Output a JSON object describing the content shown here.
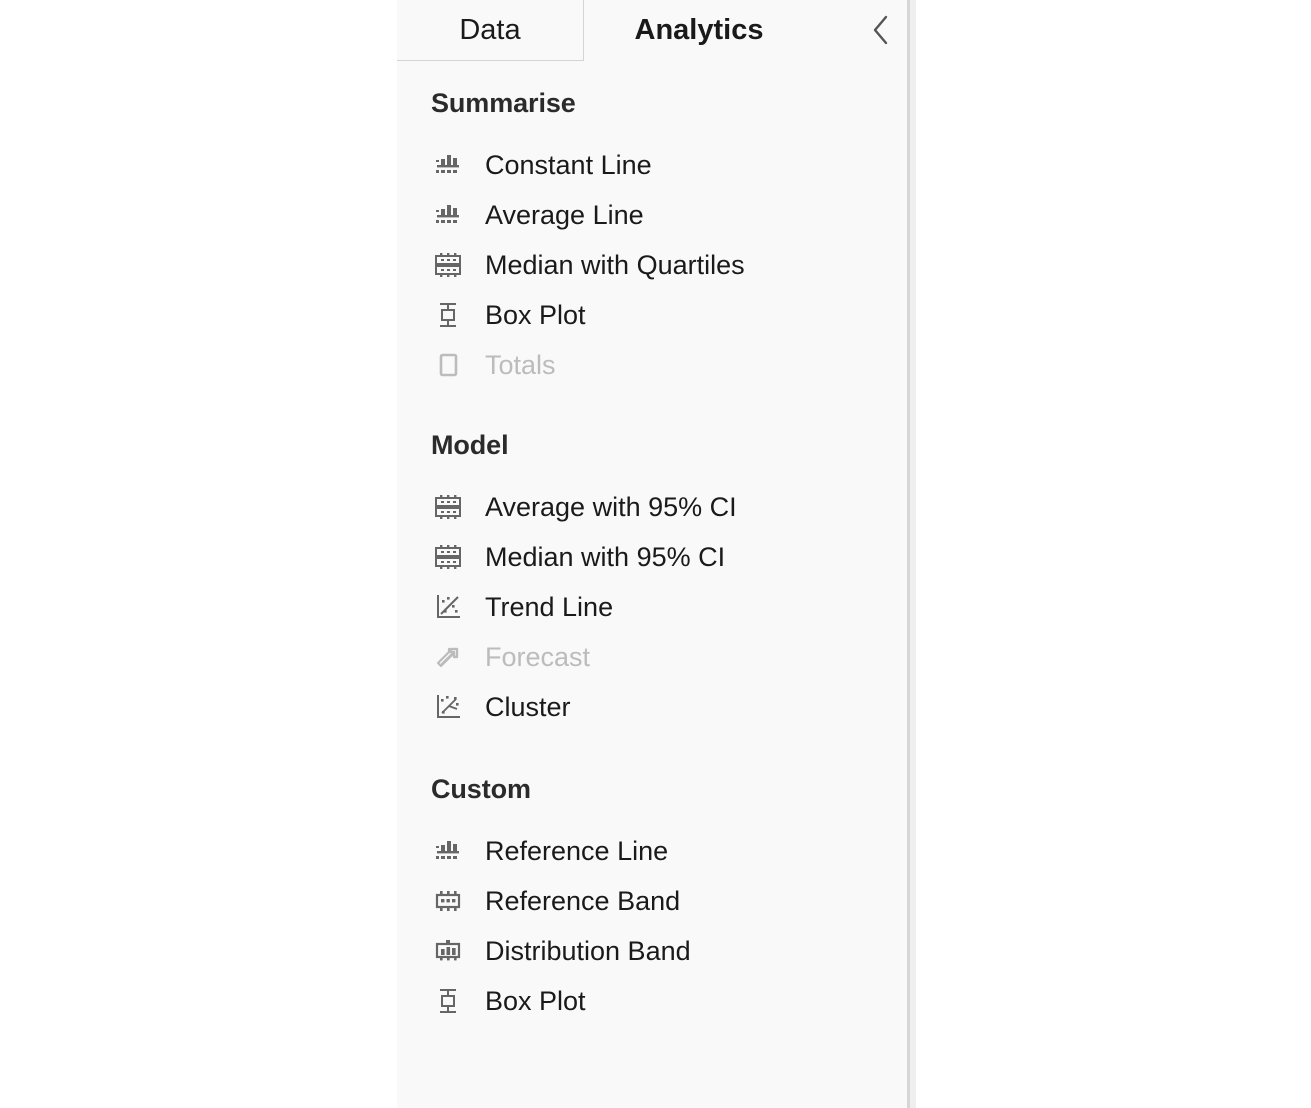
{
  "panel": {
    "tabs": [
      {
        "id": "data",
        "label": "Data",
        "active": false
      },
      {
        "id": "analytics",
        "label": "Analytics",
        "active": true
      }
    ],
    "collapse_icon": "chevron-left-icon"
  },
  "colors": {
    "panel_background": "#f9f9f9",
    "text": "#1a1a1a",
    "heading": "#2b2b2b",
    "disabled_text": "#bcbcbc",
    "icon": "#666666",
    "disabled_icon": "#bcbcbc",
    "border": "#d4d4d4",
    "divider": "#d6d6d6"
  },
  "sections": [
    {
      "id": "summarise",
      "title": "Summarise",
      "items": [
        {
          "label": "Constant Line",
          "icon": "reference-line-icon",
          "disabled": false
        },
        {
          "label": "Average Line",
          "icon": "reference-line-icon",
          "disabled": false
        },
        {
          "label": "Median with Quartiles",
          "icon": "quartile-band-icon",
          "disabled": false
        },
        {
          "label": "Box Plot",
          "icon": "box-plot-icon",
          "disabled": false
        },
        {
          "label": "Totals",
          "icon": "totals-icon",
          "disabled": true
        }
      ]
    },
    {
      "id": "model",
      "title": "Model",
      "items": [
        {
          "label": "Average with 95% CI",
          "icon": "quartile-band-icon",
          "disabled": false
        },
        {
          "label": "Median with 95% CI",
          "icon": "quartile-band-icon",
          "disabled": false
        },
        {
          "label": "Trend Line",
          "icon": "trend-line-icon",
          "disabled": false
        },
        {
          "label": "Forecast",
          "icon": "forecast-arrow-icon",
          "disabled": true
        },
        {
          "label": "Cluster",
          "icon": "cluster-icon",
          "disabled": false
        }
      ]
    },
    {
      "id": "custom",
      "title": "Custom",
      "items": [
        {
          "label": "Reference Line",
          "icon": "reference-line-icon",
          "disabled": false
        },
        {
          "label": "Reference Band",
          "icon": "reference-band-icon",
          "disabled": false
        },
        {
          "label": "Distribution Band",
          "icon": "distribution-band-icon",
          "disabled": false
        },
        {
          "label": "Box Plot",
          "icon": "box-plot-icon",
          "disabled": false
        }
      ]
    }
  ]
}
